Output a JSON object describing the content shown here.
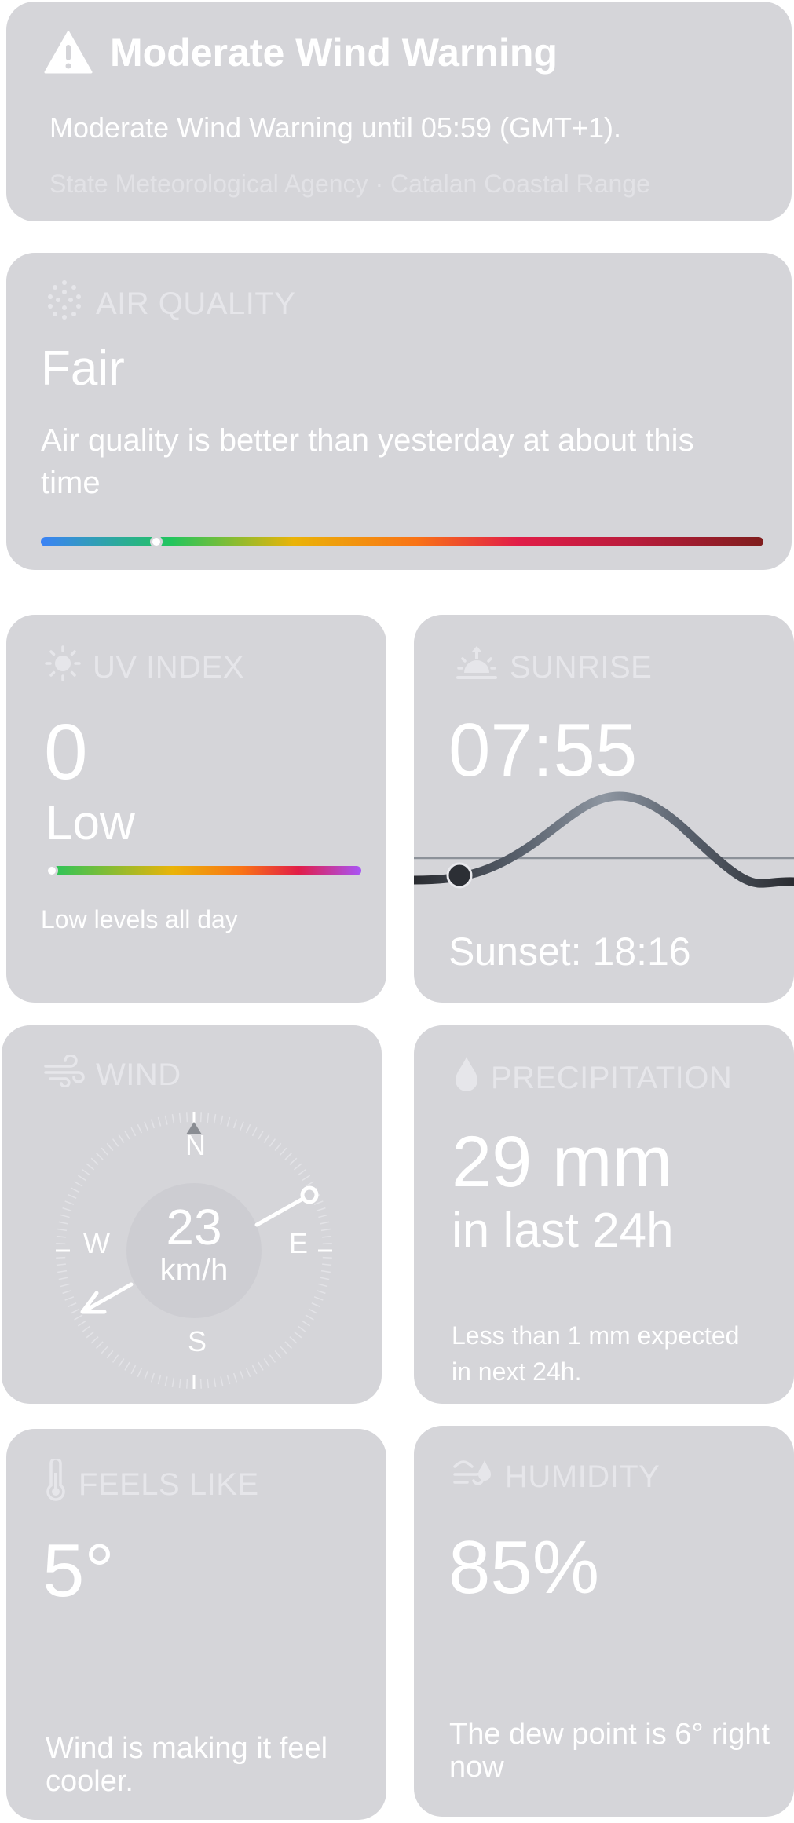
{
  "alert": {
    "title": "Moderate Wind Warning",
    "message": "Moderate Wind Warning until 05:59 (GMT+1).",
    "source": "State Meteorological Agency · Catalan Coastal Range",
    "icon": "warning-triangle-icon"
  },
  "air_quality": {
    "header": "AIR QUALITY",
    "icon": "air-quality-dots-icon",
    "category": "Fair",
    "description": "Air quality is better than yesterday at about this time",
    "indicator_fraction": 0.16
  },
  "uv_index": {
    "header": "UV INDEX",
    "icon": "sun-icon",
    "value": "0",
    "level": "Low",
    "note": "Low levels all day",
    "indicator_fraction": 0.0
  },
  "sunrise": {
    "header": "SUNRISE",
    "icon": "sunrise-icon",
    "time": "07:55",
    "sunset_text": "Sunset: 18:16"
  },
  "wind": {
    "header": "WIND",
    "icon": "wind-icon",
    "speed": "23",
    "unit": "km/h",
    "directions": {
      "n": "N",
      "e": "E",
      "s": "S",
      "w": "W"
    }
  },
  "precipitation": {
    "header": "PRECIPITATION",
    "icon": "raindrop-icon",
    "amount": "29 mm",
    "period": "in last 24h",
    "forecast": "Less than 1 mm expected in next 24h."
  },
  "feels_like": {
    "header": "FEELS LIKE",
    "icon": "thermometer-icon",
    "value": "5°",
    "note": "Wind is making it feel cooler."
  },
  "humidity": {
    "header": "HUMIDITY",
    "icon": "humidity-icon",
    "value": "85%",
    "note": "The dew point is 6° right now"
  },
  "colors": {
    "card": "#d5d5d9",
    "text": "#ffffff",
    "muted": "#e6e6ea",
    "aqi_gradient": [
      "#3b82f6",
      "#22c55e",
      "#eab308",
      "#f97316",
      "#e11d48",
      "#b91c3c",
      "#7f1d1d"
    ],
    "uv_gradient": [
      "#22c55e",
      "#eab308",
      "#f97316",
      "#e11d48",
      "#a855f7"
    ]
  }
}
